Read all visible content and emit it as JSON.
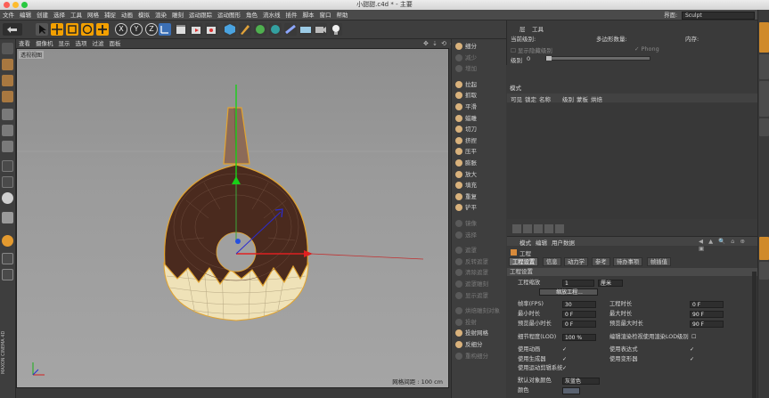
{
  "window": {
    "title": "小甜甜.c4d * - 主要"
  },
  "menu": [
    "文件",
    "编辑",
    "创建",
    "选择",
    "工具",
    "网格",
    "捕捉",
    "动画",
    "模拟",
    "渲染",
    "雕刻",
    "运动跟踪",
    "运动图形",
    "角色",
    "流水线",
    "插件",
    "脚本",
    "窗口",
    "帮助"
  ],
  "layout": {
    "label": "界面:",
    "value": "Sculpt"
  },
  "toolbar": {
    "axes": [
      "X",
      "Y",
      "Z"
    ]
  },
  "viewport": {
    "menu": [
      "查看",
      "摄像机",
      "显示",
      "选项",
      "过滤",
      "面板"
    ],
    "camera_label": "透视视图",
    "grid_status": "网格间距 : 100 cm"
  },
  "brand": {
    "line1": "MAXON",
    "line2": "CINEMA 4D"
  },
  "sculpt_tools": [
    {
      "label": "细分",
      "dim": false
    },
    {
      "label": "减少",
      "dim": true
    },
    {
      "label": "增加",
      "dim": true
    },
    {
      "label": "拉起",
      "dim": false
    },
    {
      "label": "抓取",
      "dim": false
    },
    {
      "label": "平滑",
      "dim": false
    },
    {
      "label": "蜡雕",
      "dim": false
    },
    {
      "label": "切刀",
      "dim": false
    },
    {
      "label": "挤捏",
      "dim": false
    },
    {
      "label": "压平",
      "dim": false
    },
    {
      "label": "膨胀",
      "dim": false
    },
    {
      "label": "放大",
      "dim": false
    },
    {
      "label": "填充",
      "dim": false
    },
    {
      "label": "重复",
      "dim": false
    },
    {
      "label": "铲平",
      "dim": false
    },
    {
      "label": "镜像",
      "dim": true
    },
    {
      "label": "选择",
      "dim": true
    },
    {
      "label": "遮罩",
      "dim": true
    },
    {
      "label": "反转遮罩",
      "dim": true
    },
    {
      "label": "清除遮罩",
      "dim": true
    },
    {
      "label": "遮罩雕刻",
      "dim": true
    },
    {
      "label": "显示遮罩",
      "dim": true
    },
    {
      "label": "烘焙雕刻对象",
      "dim": true
    },
    {
      "label": "投射",
      "dim": true
    },
    {
      "label": "投射网格",
      "dim": false
    },
    {
      "label": "反细分",
      "dim": false
    },
    {
      "label": "重构细分",
      "dim": true
    }
  ],
  "layer_panel": {
    "menu": [
      "层",
      "工具"
    ],
    "current_level_label": "当前级别:",
    "poly_count_label": "多边形数量:",
    "memory_label": "内存:",
    "phong_label": "Phong",
    "hide_label": "显示隐藏级别",
    "level_label": "级别",
    "level_value": "0"
  },
  "modes_label": "模式",
  "layer_columns": [
    "可见",
    "锁定",
    "名称",
    "级别",
    "蒙板",
    "烘焙"
  ],
  "attributes": {
    "menu": [
      "模式",
      "编辑",
      "用户数据"
    ],
    "object_label": "工程",
    "tabs": [
      "工程设置",
      "信息",
      "动力学",
      "参考",
      "待办事项",
      "帧插值"
    ],
    "section": "工程设置",
    "scale_label": "工程缩放",
    "scale_value": "1",
    "scale_unit": "厘米",
    "scale_button": "缩放工程...",
    "fps_label": "帧率(FPS)",
    "fps_value": "30",
    "project_time_label": "工程时长",
    "project_time_value": "0 F",
    "min_time_label": "最小时长",
    "min_time_value": "0 F",
    "max_time_label": "最大时长",
    "max_time_value": "90 F",
    "preview_min_label": "预览最小时长",
    "preview_min_value": "0 F",
    "preview_max_label": "预览最大时长",
    "preview_max_value": "90 F",
    "lod_label": "细节程度(LOD)",
    "lod_value": "100 %",
    "render_lod_label": "编辑渲染检视使用渲染LOD级别",
    "use_anim_label": "使用动画",
    "use_expr_label": "使用表达式",
    "use_gen_label": "使用生成器",
    "use_deform_label": "使用变形器",
    "use_motion_label": "使用运动剪辑系统",
    "default_color_label": "默认对象颜色",
    "default_color_value": "灰蓝色",
    "color_label": "颜色"
  },
  "colors": {
    "accent": "#f3a000",
    "chocolate": "#4a2a1e",
    "dough": "#efe2b8"
  }
}
